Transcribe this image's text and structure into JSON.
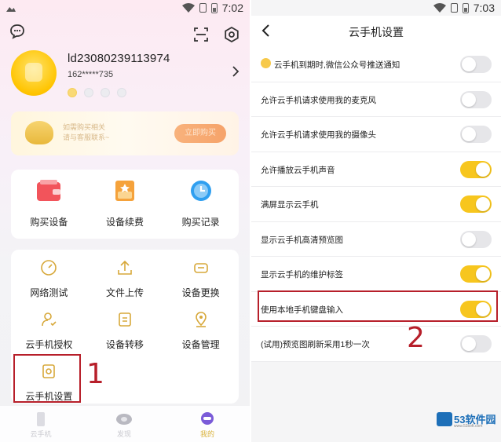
{
  "left": {
    "status_time": "7:02",
    "user_id": "ld23080239113974",
    "user_phone": "162*****735",
    "promo": {
      "text_line1": "如需购买相关",
      "text_line2": "请与客服联系~",
      "button": "立即购买"
    },
    "quick": [
      {
        "label": "购买设备",
        "icon": "wallet-icon"
      },
      {
        "label": "设备续费",
        "icon": "renew-icon"
      },
      {
        "label": "购买记录",
        "icon": "clock-icon"
      }
    ],
    "tools": [
      {
        "label": "网络测试",
        "icon": "speedometer-icon"
      },
      {
        "label": "文件上传",
        "icon": "upload-icon"
      },
      {
        "label": "设备更换",
        "icon": "swap-icon"
      },
      {
        "label": "云手机授权",
        "icon": "user-auth-icon"
      },
      {
        "label": "设备转移",
        "icon": "transfer-icon"
      },
      {
        "label": "设备管理",
        "icon": "device-manage-icon"
      },
      {
        "label": "云手机设置",
        "icon": "phone-settings-icon"
      }
    ],
    "annotation_number": "1",
    "tabs": [
      {
        "label": "云手机"
      },
      {
        "label": "发现"
      },
      {
        "label": "我的"
      }
    ]
  },
  "right": {
    "status_time": "7:03",
    "title": "云手机设置",
    "settings": [
      {
        "label": "云手机到期时,微信公众号推送通知",
        "on": false
      },
      {
        "label": "允许云手机请求使用我的麦克风",
        "on": false
      },
      {
        "label": "允许云手机请求使用我的摄像头",
        "on": false
      },
      {
        "label": "允许播放云手机声音",
        "on": true
      },
      {
        "label": "满屏显示云手机",
        "on": true
      },
      {
        "label": "显示云手机高清预览图",
        "on": false
      },
      {
        "label": "显示云手机的维护标签",
        "on": true
      },
      {
        "label": "使用本地手机键盘输入",
        "on": true
      },
      {
        "label": "(试用)预览图刷新采用1秒一次",
        "on": false
      }
    ],
    "annotation_number": "2",
    "watermark": "53软件园",
    "watermark_url": "www.53soft.com"
  },
  "colors": {
    "accent_yellow": "#f7c61e",
    "annotation_red": "#b71f2a"
  }
}
